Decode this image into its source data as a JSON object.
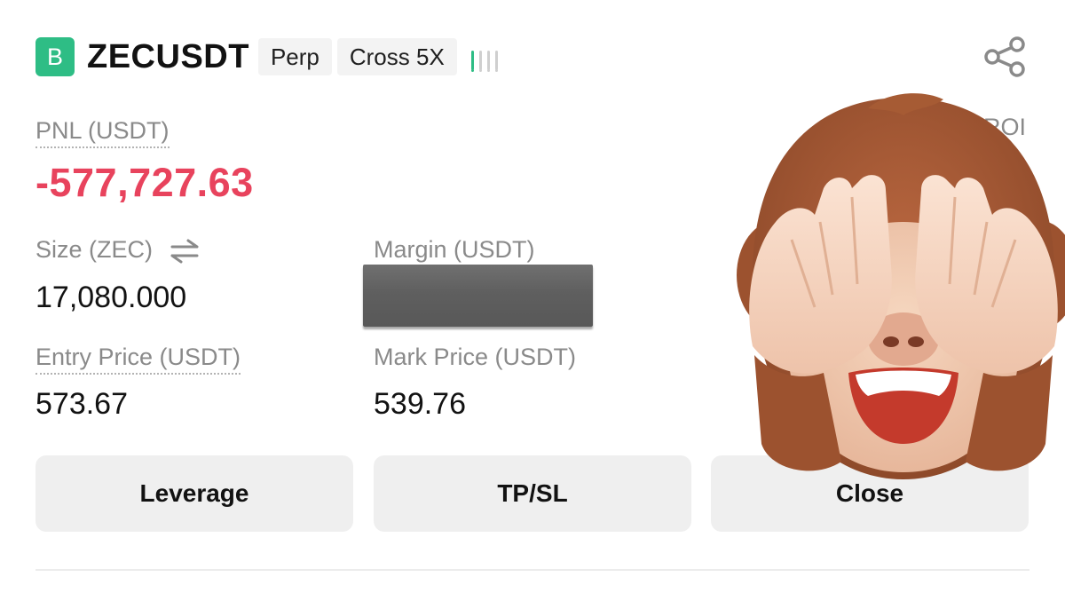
{
  "position": {
    "side_badge": "B",
    "symbol": "ZECUSDT",
    "tags": [
      "Perp",
      "Cross 5X"
    ],
    "risk_bars": [
      "#2ebd85",
      "#cfcfcf",
      "#cfcfcf",
      "#cfcfcf"
    ]
  },
  "pnl": {
    "label": "PNL (USDT)",
    "value": "-577,727.63",
    "color": "#e8435d"
  },
  "roi": {
    "label_partial": "ROI"
  },
  "fields": {
    "size": {
      "label": "Size (ZEC)",
      "value": "17,080.000"
    },
    "margin": {
      "label": "Margin (USDT)"
    },
    "entry_price": {
      "label": "Entry Price (USDT)",
      "value": "573.67"
    },
    "mark_price": {
      "label": "Mark Price (USDT)",
      "value": "539.76"
    }
  },
  "buttons": {
    "leverage": "Leverage",
    "tpsl": "TP/SL",
    "close": "Close"
  },
  "icons": {
    "share": "share-icon",
    "swap": "swap-arrows-icon",
    "overlay": "see-no-evil-monkey-emoji"
  }
}
